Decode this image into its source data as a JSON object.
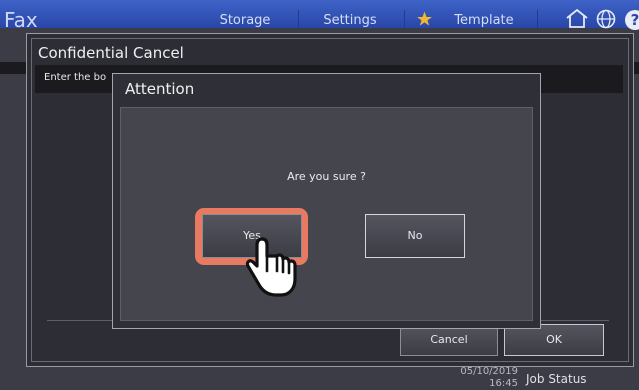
{
  "header": {
    "app_title": "Fax",
    "tabs": [
      "Storage",
      "Settings",
      "Template"
    ],
    "icons": [
      "star-icon",
      "home-icon",
      "globe-icon",
      "help-icon"
    ],
    "accent_color": "#2947a8"
  },
  "outer_dialog": {
    "title": "Confidential Cancel",
    "instruction": "Enter the bo",
    "cancel_label": "Cancel",
    "ok_label": "OK"
  },
  "attention_dialog": {
    "title": "Attention",
    "question": "Are you sure ?",
    "yes_label": "Yes",
    "no_label": "No",
    "highlight_color": "#e77a61"
  },
  "status_bar": {
    "date": "05/10/2019",
    "time": "16:45",
    "job_status_label": "Job Status"
  },
  "cursor": {
    "icon": "pointing-hand-icon"
  }
}
